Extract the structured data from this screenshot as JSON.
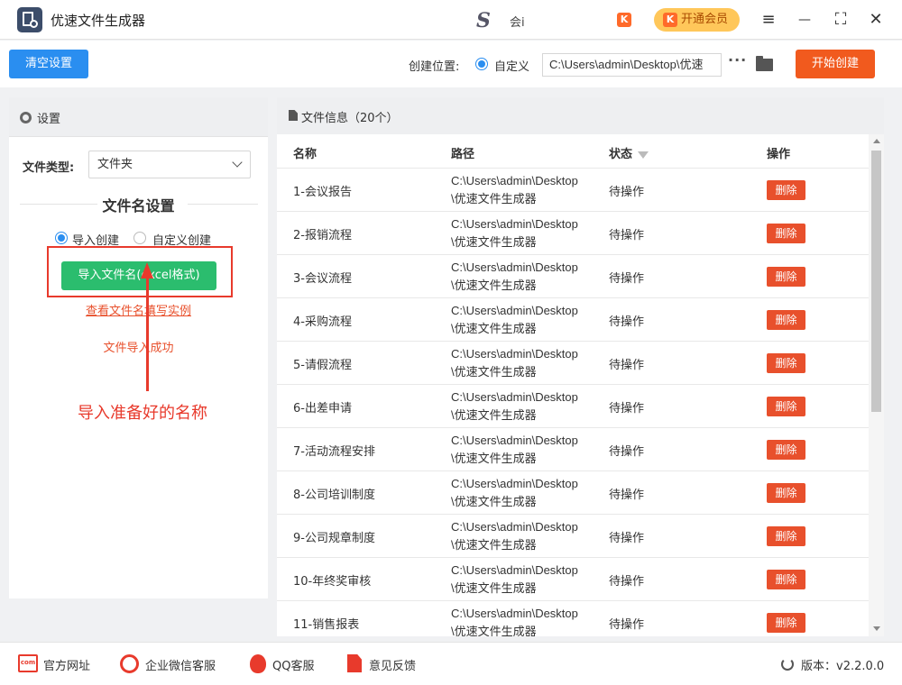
{
  "app": {
    "title": "优速文件生成器",
    "center_logo": "S",
    "center_text": "会i",
    "vip_label": "开通会员",
    "vip_icon_glyph": "K",
    "win_controls": {
      "menu": "≡",
      "minimize": "—",
      "maximize": "⛶",
      "close": "✕"
    }
  },
  "toolbar": {
    "clear_label": "清空设置",
    "location_label": "创建位置:",
    "radio_custom_label": "自定义",
    "path_value": "C:\\Users\\admin\\Desktop\\优速",
    "more_label": "···",
    "start_label": "开始创建"
  },
  "settings": {
    "header": "设置",
    "file_type_label": "文件类型:",
    "file_type_value": "文件夹",
    "section_title": "文件名设置",
    "radio_import_label": "导入创建",
    "radio_custom_label": "自定义创建",
    "import_button_label": "导入文件名(excel格式)",
    "example_link": "查看文件名填写实例",
    "import_status": "文件导入成功",
    "annotation": "导入准备好的名称"
  },
  "files": {
    "header": "文件信息（20个）",
    "columns": {
      "name": "名称",
      "path": "路径",
      "status": "状态",
      "action": "操作"
    },
    "rows": [
      {
        "name": "1-会议报告",
        "path": "C:\\Users\\admin\\Desktop\\优速文件生成器",
        "status": "待操作",
        "action": "删除"
      },
      {
        "name": "2-报销流程",
        "path": "C:\\Users\\admin\\Desktop\\优速文件生成器",
        "status": "待操作",
        "action": "删除"
      },
      {
        "name": "3-会议流程",
        "path": "C:\\Users\\admin\\Desktop\\优速文件生成器",
        "status": "待操作",
        "action": "删除"
      },
      {
        "name": "4-采购流程",
        "path": "C:\\Users\\admin\\Desktop\\优速文件生成器",
        "status": "待操作",
        "action": "删除"
      },
      {
        "name": "5-请假流程",
        "path": "C:\\Users\\admin\\Desktop\\优速文件生成器",
        "status": "待操作",
        "action": "删除"
      },
      {
        "name": "6-出差申请",
        "path": "C:\\Users\\admin\\Desktop\\优速文件生成器",
        "status": "待操作",
        "action": "删除"
      },
      {
        "name": "7-活动流程安排",
        "path": "C:\\Users\\admin\\Desktop\\优速文件生成器",
        "status": "待操作",
        "action": "删除"
      },
      {
        "name": "8-公司培训制度",
        "path": "C:\\Users\\admin\\Desktop\\优速文件生成器",
        "status": "待操作",
        "action": "删除"
      },
      {
        "name": "9-公司规章制度",
        "path": "C:\\Users\\admin\\Desktop\\优速文件生成器",
        "status": "待操作",
        "action": "删除"
      },
      {
        "name": "10-年终奖审核",
        "path": "C:\\Users\\admin\\Desktop\\优速文件生成器",
        "status": "待操作",
        "action": "删除"
      },
      {
        "name": "11-销售报表",
        "path": "C:\\Users\\admin\\Desktop\\优速文件生成器",
        "status": "待操作",
        "action": "删除"
      }
    ]
  },
  "footer": {
    "website": "官方网址",
    "website_icon_text": "com",
    "wechat": "企业微信客服",
    "qq": "QQ客服",
    "feedback": "意见反馈",
    "version": "版本：v2.2.0.0"
  },
  "colors": {
    "primary_blue": "#2a8ef0",
    "start_orange": "#f15a1e",
    "import_green": "#2bbd6e",
    "delete_red": "#e8502c",
    "annotation_red": "#e83a2c",
    "vip_gold": "#ffc75a"
  }
}
